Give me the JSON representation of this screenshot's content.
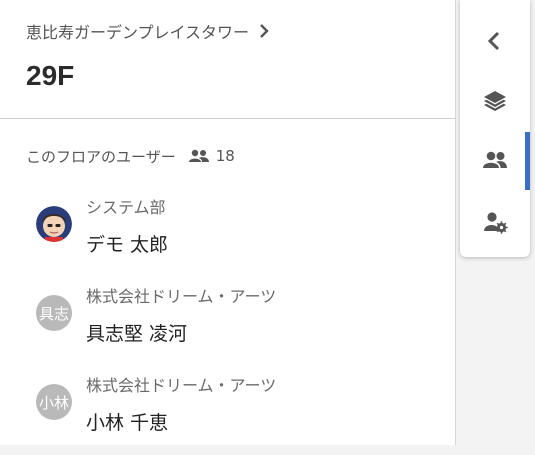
{
  "header": {
    "building_name": "恵比寿ガーデンプレイスタワー",
    "floor": "29F"
  },
  "users_section": {
    "title": "このフロアのユーザー",
    "count": "18"
  },
  "users": [
    {
      "department": "システム部",
      "name": "デモ 太郎",
      "avatar": "photo"
    },
    {
      "department": "株式会社ドリーム・アーツ",
      "name": "具志堅 凌河",
      "avatar_text": "具志"
    },
    {
      "department": "株式会社ドリーム・アーツ",
      "name": "小林 千恵",
      "avatar_text": "小林"
    }
  ],
  "rail": {
    "buttons": [
      "chevron-left-icon",
      "layers-icon",
      "group-icon",
      "user-settings-icon"
    ],
    "active": "group-icon",
    "accent_color": "#3b6fc4"
  }
}
